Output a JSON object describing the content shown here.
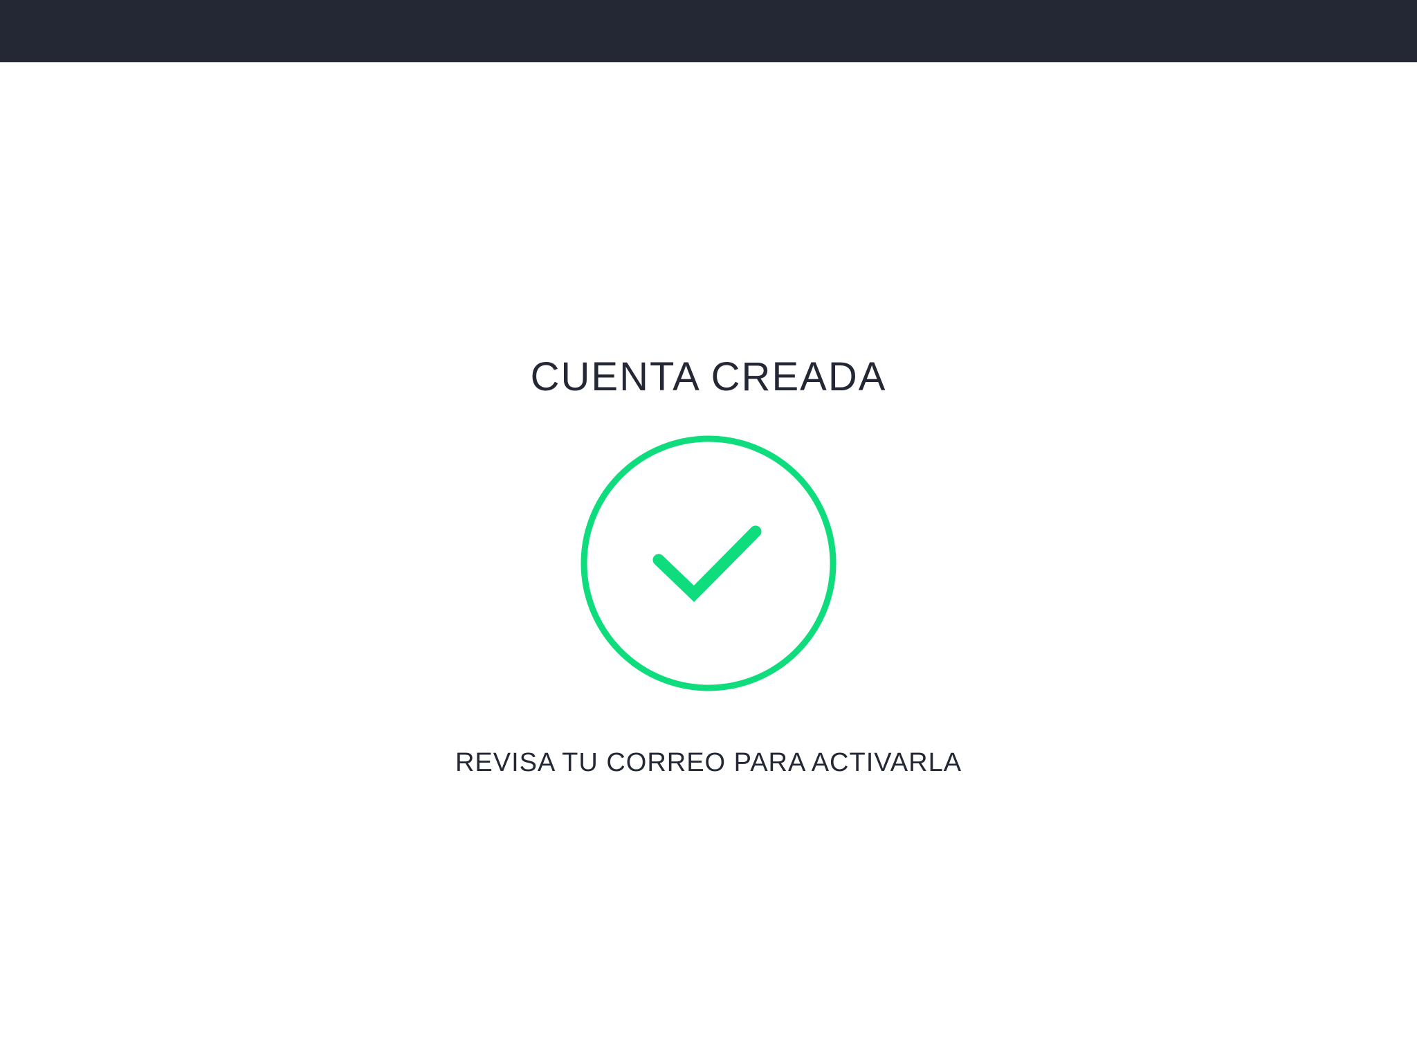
{
  "colors": {
    "topbar": "#232834",
    "text": "#232834",
    "success": "#0fdc7c",
    "background": "#ffffff"
  },
  "confirmation": {
    "title": "CUENTA CREADA",
    "icon": "check-circle-icon",
    "message": "REVISA TU CORREO PARA ACTIVARLA"
  }
}
